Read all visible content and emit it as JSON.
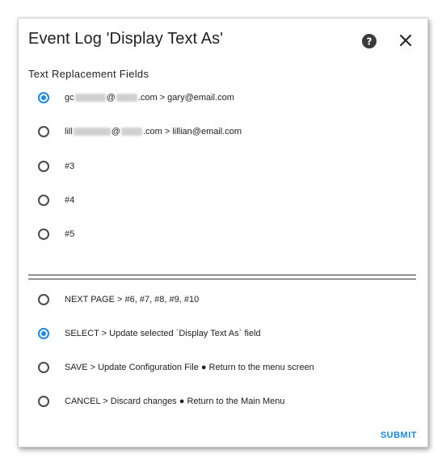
{
  "dialog": {
    "title": "Event Log 'Display Text As'",
    "help_icon": "help-circle-icon",
    "close_icon": "close-icon"
  },
  "section": {
    "label": "Text Replacement Fields"
  },
  "fields": [
    {
      "prefix": "gc",
      "at": "@",
      "suffix": ".com > gary@email.com",
      "checked": true
    },
    {
      "prefix": "lill",
      "at": "@",
      "suffix": ".com > lillian@email.com",
      "checked": false
    },
    {
      "label": "#3",
      "checked": false
    },
    {
      "label": "#4",
      "checked": false
    },
    {
      "label": "#5",
      "checked": false
    }
  ],
  "actions": [
    {
      "label": "NEXT PAGE > #6, #7, #8, #9, #10",
      "checked": false
    },
    {
      "label": "SELECT > Update selected `Display Text As` field",
      "checked": true
    },
    {
      "label": "SAVE > Update Configuration File ● Return to the menu screen",
      "checked": false
    },
    {
      "label": "CANCEL > Discard changes ● Return to the Main Menu",
      "checked": false
    }
  ],
  "footer": {
    "submit_label": "SUBMIT"
  },
  "colors": {
    "accent": "#1e88e5",
    "text": "#212121"
  }
}
